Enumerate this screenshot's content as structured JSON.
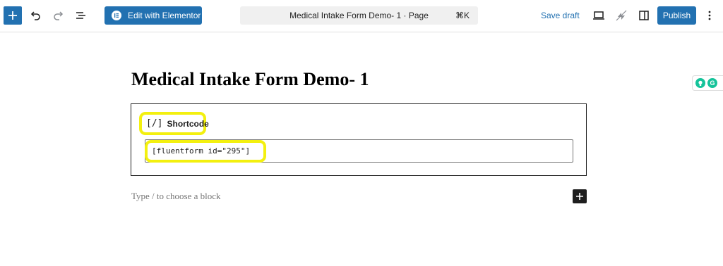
{
  "toolbar": {
    "elementor_label": "Edit with Elementor",
    "document_title": "Medical Intake Form Demo- 1 · Page",
    "command_shortcut": "⌘K",
    "save_draft_label": "Save draft",
    "publish_label": "Publish"
  },
  "editor": {
    "post_title": "Medical Intake Form Demo- 1",
    "shortcode_block": {
      "label_icon": "[/]",
      "label": "Shortcode",
      "value": "[fluentform id=\"295\"]"
    },
    "appender_placeholder": "Type / to choose a block"
  },
  "colors": {
    "accent": "#2271b1",
    "highlight": "#f3f00f",
    "grammarly": "#15c39a"
  }
}
